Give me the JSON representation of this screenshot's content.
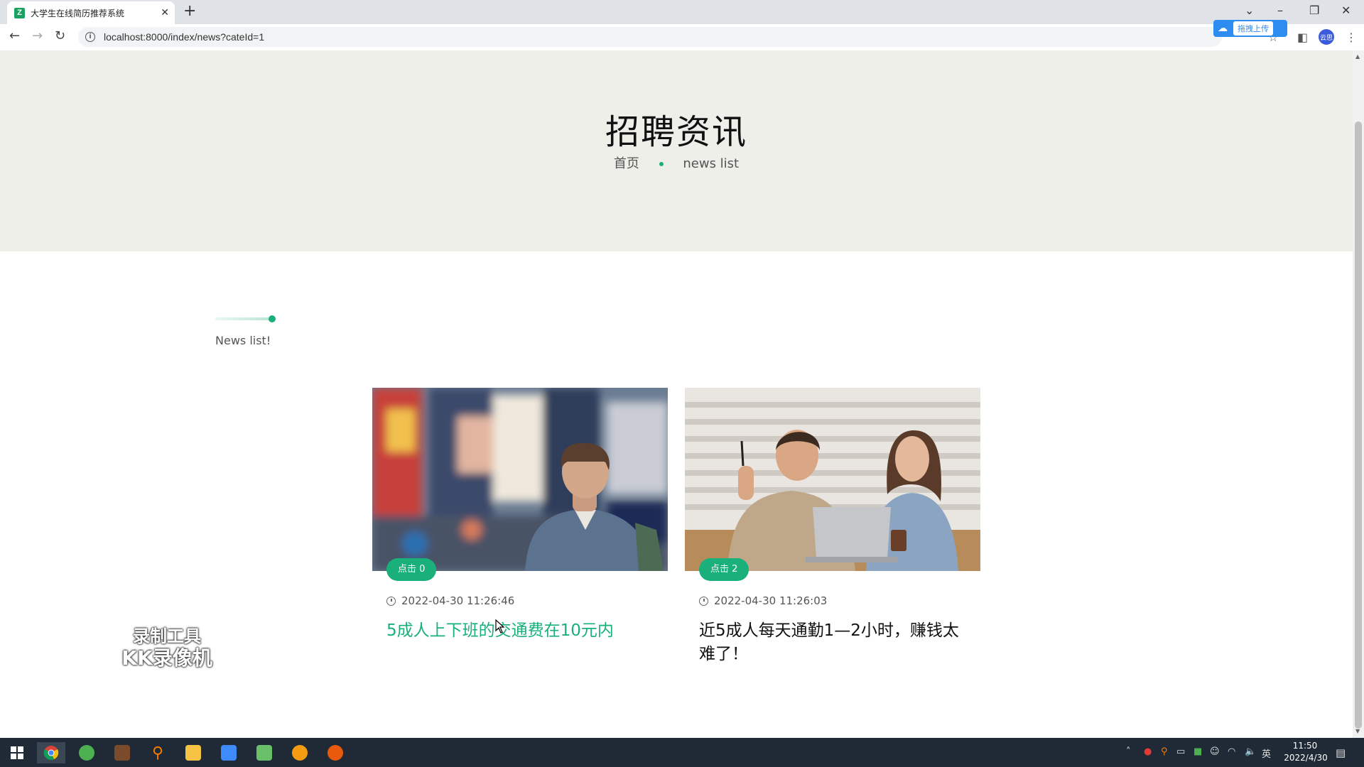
{
  "browser": {
    "tab_title": "大学生在线简历推荐系统",
    "tab_favicon": "Z",
    "url": "localhost:8000/index/news?cateId=1",
    "extension_label": "拖拽上传",
    "profile_label": "云思"
  },
  "hero": {
    "title": "招聘资讯",
    "breadcrumb_home": "首页",
    "breadcrumb_current": "news list"
  },
  "section": {
    "label": "News list!"
  },
  "colors": {
    "accent": "#19b07a",
    "hero_bg": "#efefea"
  },
  "cards": [
    {
      "badge": "点击 0",
      "date": "2022-04-30 11:26:46",
      "title": "5成人上下班的交通费在10元内",
      "title_color": "#19b07a",
      "image": "man-in-city-street-photo"
    },
    {
      "badge": "点击 2",
      "date": "2022-04-30 11:26:03",
      "title": "近5成人每天通勤1—2小时，赚钱太难了！",
      "title_color": "#111111",
      "image": "two-people-at-laptop-photo"
    }
  ],
  "watermark": {
    "line1": "录制工具",
    "line2": "KK录像机"
  },
  "taskbar": {
    "time": "11:50",
    "date": "2022/4/30",
    "ime": "英"
  }
}
